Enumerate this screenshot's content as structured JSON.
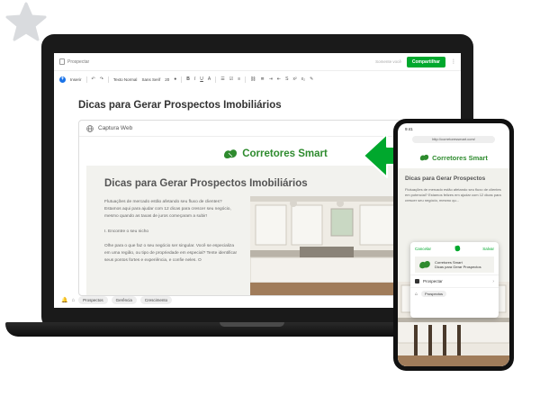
{
  "app": {
    "breadcrumb": "Prospectar",
    "visibility": "Somente você",
    "share_label": "Compartilhar",
    "more_label": "⋮",
    "toolbar": {
      "insert": "Inserir",
      "style": "Texto Normal",
      "font": "Sans Serif",
      "size": "20"
    }
  },
  "note": {
    "title": "Dicas para Gerar Prospectos Imobiliários",
    "clip_label": "Captura Web",
    "tags": [
      "Prospectos",
      "Gerência",
      "Crescimento"
    ]
  },
  "site": {
    "brand": "Corretores Smart",
    "article_title": "Dicas para Gerar Prospectos Imobiliários",
    "paragraphs": [
      "Flutuações de mercado estão afetando seu fluxo de clientes? Estamos aqui para ajudar com 12 dicas para crescer seu negócio, mesmo quando as taxas de juros começaram a subir!",
      "I. Encontre o seu nicho",
      "Olhe para o que faz o seu negócio ser singular. Você se especializa em uma região, ou tipo de propriedade em especial? Tente identificar seus pontos fortes e experiência, e confie neles. O"
    ]
  },
  "phone": {
    "time": "9:41",
    "url": "http://corretoressmart.com/",
    "brand": "Corretores Smart",
    "article_title": "Dicas para Gerar Prospectos",
    "text": "Flutuações de mercado estão afetando seu fluxo de clientes em potencial? Estamos felizes em ajudar com 12 dicas para crescer seu negócio, mesmo qu...",
    "sheet": {
      "cancel": "Cancelar",
      "save": "Salvar",
      "preview_line1": "Corretores Smart",
      "preview_line2": "Dicas para Gerar Prospectos",
      "notebook": "Prospectar",
      "tag": "Prospectos"
    }
  },
  "colors": {
    "accent_green": "#00a82d",
    "brand_green": "#2e8b2e"
  }
}
